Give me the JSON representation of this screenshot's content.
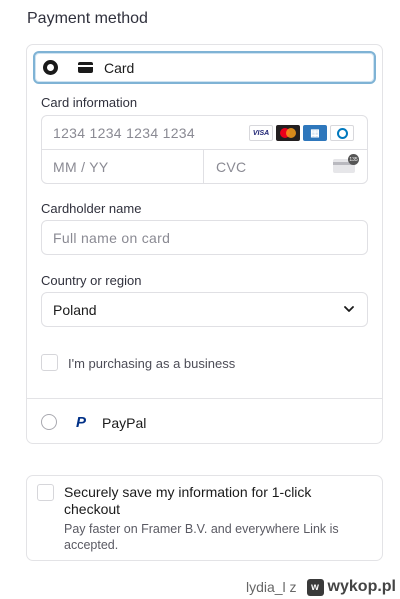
{
  "payment": {
    "title": "Payment method",
    "card_option": {
      "label": "Card",
      "selected": true
    },
    "card_information_label": "Card information",
    "card_number_placeholder": "1234 1234 1234 1234",
    "expiry_placeholder": "MM / YY",
    "cvc_placeholder": "CVC",
    "card_brands": [
      {
        "name": "visa-icon",
        "text": "VISA",
        "color": "#1a1f71"
      },
      {
        "name": "mastercard-icon",
        "text": "",
        "color": "#eb001b"
      },
      {
        "name": "amex-icon",
        "text": "",
        "color": "#2e77bc"
      },
      {
        "name": "diners-icon",
        "text": "",
        "color": "#0079be"
      }
    ],
    "cvc_badge": "135",
    "cardholder_label": "Cardholder name",
    "cardholder_placeholder": "Full name on card",
    "country_label": "Country or region",
    "country_value": "Poland",
    "business_label": "I'm purchasing as a business",
    "business_checked": false,
    "paypal_option": {
      "label": "PayPal",
      "selected": false,
      "icon": "P"
    }
  },
  "save_info": {
    "title": "Securely save my information for 1-click checkout",
    "description": "Pay faster on Framer B.V. and everywhere Link is accepted.",
    "checked": false
  },
  "watermark": {
    "user": "lydia_l z",
    "logo": "w",
    "brand": "wykop.pl"
  },
  "colors": {
    "focus_border": "#7fb3d5",
    "text": "#1a1a1a",
    "placeholder": "#8a8a93",
    "border": "#e0e0e4"
  }
}
